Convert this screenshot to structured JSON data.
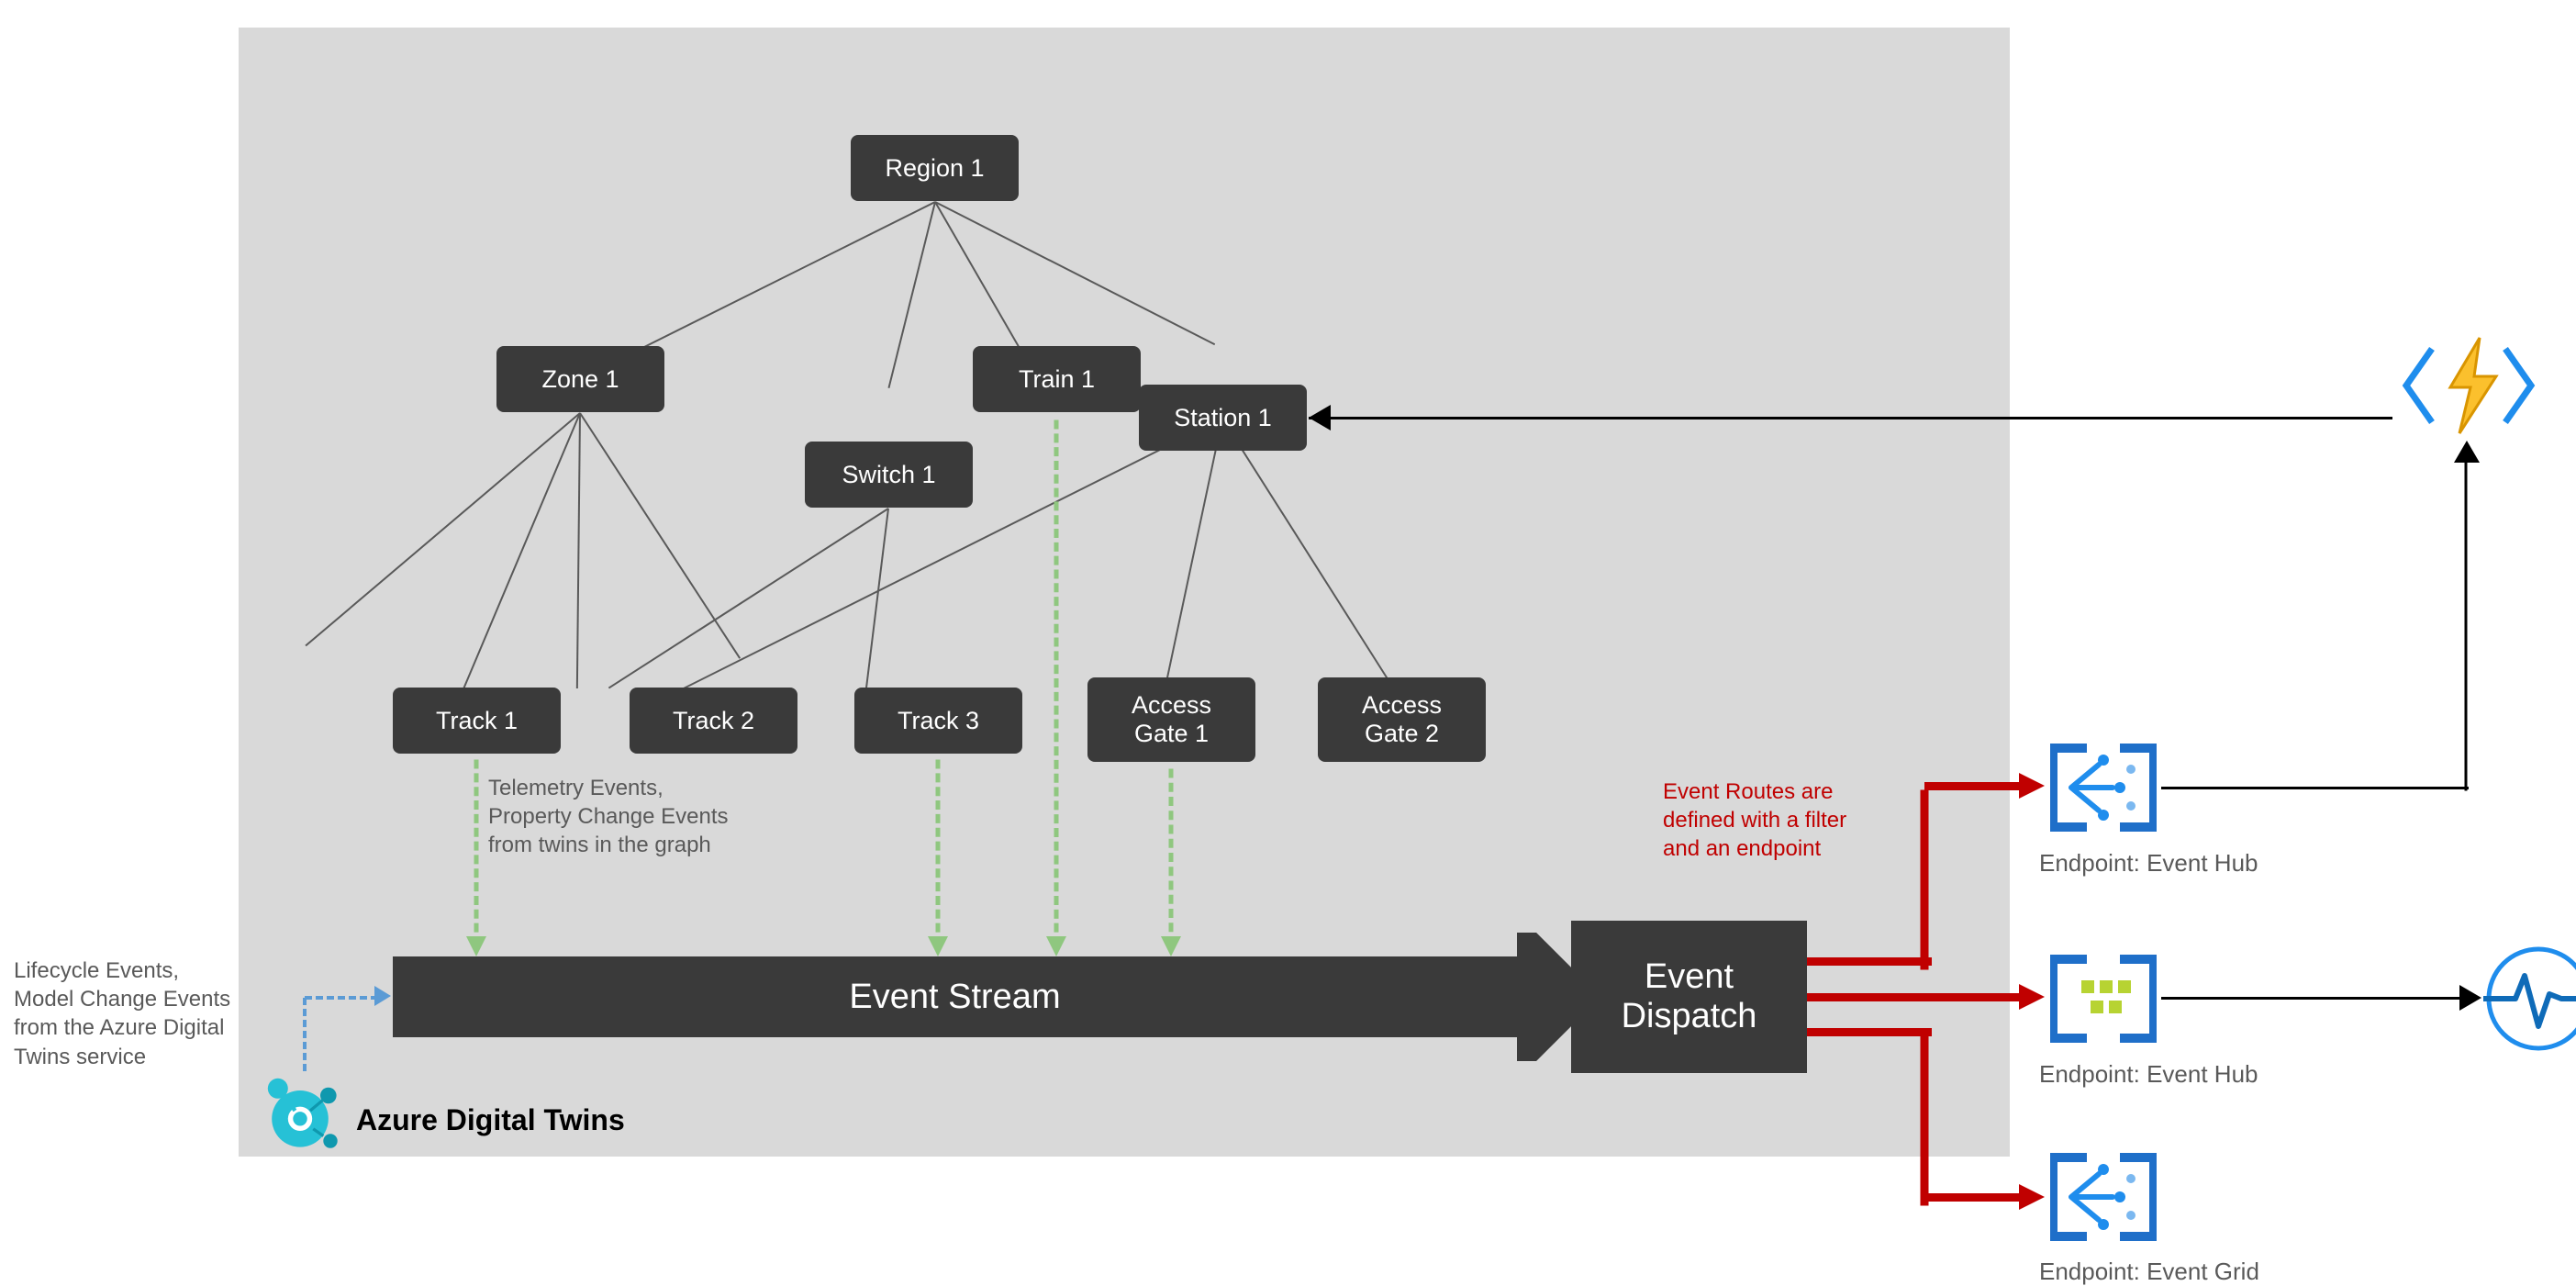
{
  "nodes": {
    "region1": "Region 1",
    "zone1": "Zone 1",
    "train1": "Train 1",
    "station1": "Station 1",
    "switch1": "Switch 1",
    "track1": "Track 1",
    "track2": "Track 2",
    "track3": "Track 3",
    "gate1": "Access\nGate 1",
    "gate2": "Access\nGate 2"
  },
  "bars": {
    "stream": "Event Stream",
    "dispatch": "Event\nDispatch"
  },
  "annotations": {
    "telemetry": "Telemetry Events,\nProperty Change Events\nfrom twins in the graph",
    "lifecycle": "Lifecycle Events,\nModel Change Events\nfrom the Azure Digital\nTwins service",
    "routes": "Event Routes are\ndefined with a filter\nand an endpoint",
    "adt": "Azure Digital Twins"
  },
  "endpoints": {
    "eh1": "Endpoint: Event Hub",
    "eh2": "Endpoint: Event Hub",
    "eg": "Endpoint: Event Grid"
  },
  "icons": {
    "adt": "azure-digital-twins-icon",
    "function": "azure-function-icon",
    "eventhub": "event-hub-icon",
    "eventgrid": "event-grid-icon",
    "analytics": "pulse-icon"
  },
  "colors": {
    "node": "#3a3a3a",
    "canvas": "#d9d9d9",
    "route": "#c00000",
    "twin_event": "#8fc77f",
    "azure_blue": "#0078d4"
  }
}
